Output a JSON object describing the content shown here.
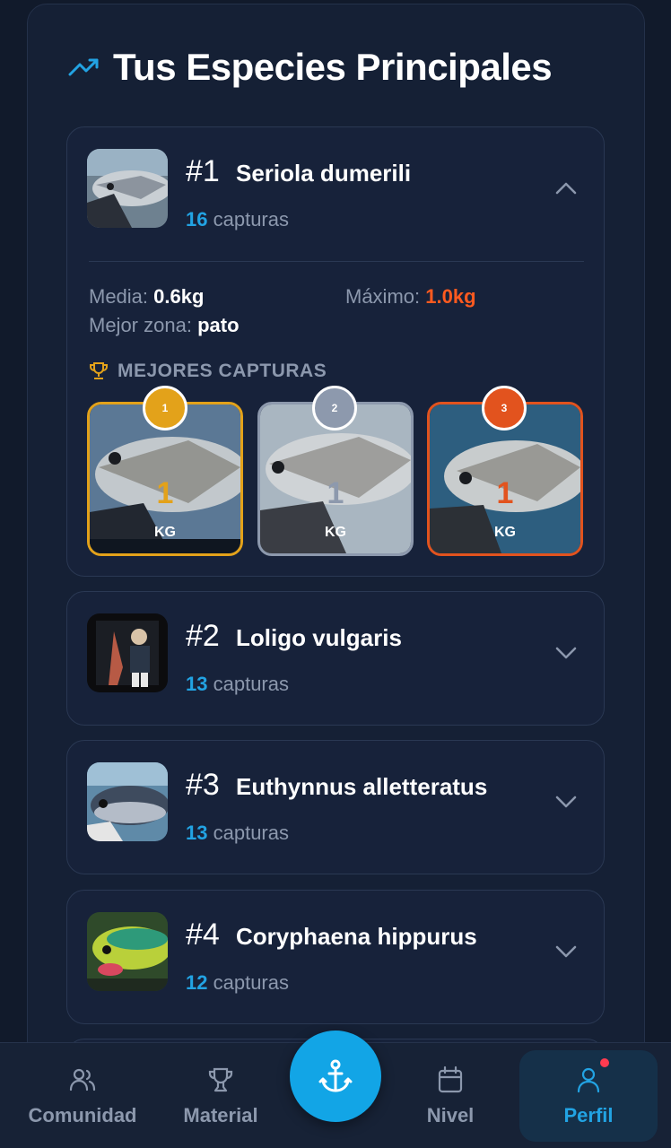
{
  "section": {
    "title": "Tus Especies Principales"
  },
  "species": [
    {
      "rank": "#1",
      "name": "Seriola dumerili",
      "count": "16",
      "count_label": "capturas",
      "expanded": true
    },
    {
      "rank": "#2",
      "name": "Loligo vulgaris",
      "count": "13",
      "count_label": "capturas",
      "expanded": false
    },
    {
      "rank": "#3",
      "name": "Euthynnus alletteratus",
      "count": "13",
      "count_label": "capturas",
      "expanded": false
    },
    {
      "rank": "#4",
      "name": "Coryphaena hippurus",
      "count": "12",
      "count_label": "capturas",
      "expanded": false
    }
  ],
  "details": {
    "media_label": "Media:",
    "media_value": "0.6kg",
    "max_label": "Máximo:",
    "max_value": "1.0kg",
    "zone_label": "Mejor zona:",
    "zone_value": "pato",
    "best_title": "MEJORES CAPTURAS",
    "best": [
      {
        "weight": "1",
        "unit": "KG",
        "medal": "1",
        "color": "#e3a21a"
      },
      {
        "weight": "1",
        "unit": "KG",
        "medal": "2",
        "color": "#8d99ad"
      },
      {
        "weight": "1",
        "unit": "KG",
        "medal": "3",
        "color": "#e2531e"
      }
    ]
  },
  "nav": {
    "items": [
      {
        "label": "Comunidad",
        "icon": "users-icon"
      },
      {
        "label": "Material",
        "icon": "trophy-icon"
      },
      {
        "label": "",
        "icon": "anchor-icon"
      },
      {
        "label": "Nivel",
        "icon": "calendar-icon"
      },
      {
        "label": "Perfil",
        "icon": "user-icon",
        "active": true
      }
    ]
  },
  "colors": {
    "accent": "#22a3e3",
    "max": "#ff5a1f",
    "gold": "#e3a21a",
    "silver": "#8d99ad",
    "bronze": "#e2531e"
  }
}
